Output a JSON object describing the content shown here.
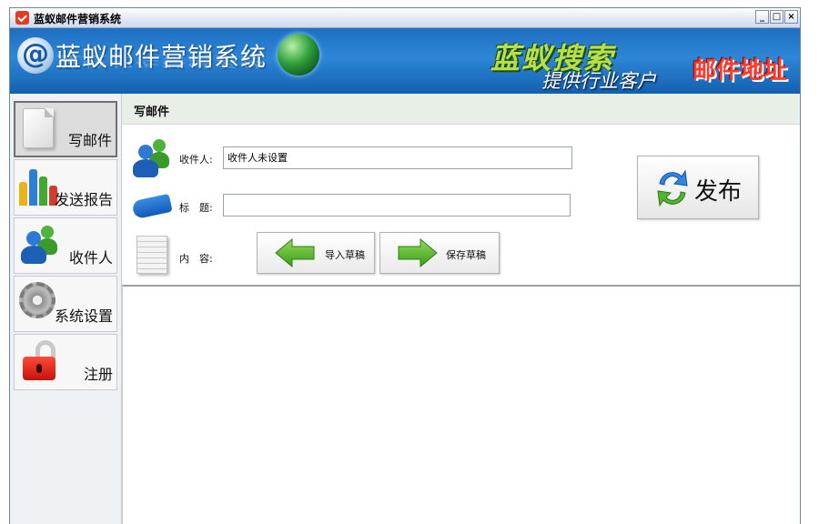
{
  "window": {
    "title": "蓝蚁邮件营销系统",
    "controls": [
      "_",
      "□",
      "×"
    ]
  },
  "banner": {
    "at_symbol": "@",
    "title": "蓝蚁邮件营销系统",
    "slogan_main": "蓝蚁搜索",
    "slogan_sub": "提供行业客户",
    "slogan_highlight": "邮件地址"
  },
  "sidebar": {
    "items": [
      {
        "label": "写邮件",
        "icon": "document-icon",
        "active": true
      },
      {
        "label": "发送报告",
        "icon": "bar-chart-icon",
        "active": false
      },
      {
        "label": "收件人",
        "icon": "users-icon",
        "active": false
      },
      {
        "label": "系统设置",
        "icon": "gear-icon",
        "active": false
      },
      {
        "label": "注册",
        "icon": "unlock-icon",
        "active": false
      }
    ]
  },
  "compose": {
    "section_title": "写邮件",
    "recipient_label": "收件人:",
    "recipient_value": "收件人未设置",
    "subject_label": "标　题:",
    "subject_value": "",
    "content_label": "内　容:",
    "import_draft": "导入草稿",
    "save_draft": "保存草稿",
    "publish": "发布"
  },
  "colors": {
    "banner_blue": "#1f6fc1",
    "accent_green": "#4caf2a",
    "accent_red": "#ff3b2d"
  }
}
